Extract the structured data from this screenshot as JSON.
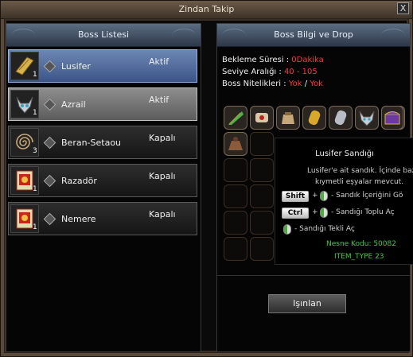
{
  "window": {
    "title": "Zindan Takip",
    "close_label": "X"
  },
  "boss_list": {
    "header": "Boss Listesi",
    "items": [
      {
        "name": "Lusifer",
        "status": "Aktif",
        "count": "1",
        "icon": "scroll-gold-icon",
        "state": "selected-blue"
      },
      {
        "name": "Azrail",
        "status": "Aktif",
        "count": "1",
        "icon": "horned-helmet-icon",
        "state": "selected-grey"
      },
      {
        "name": "Beran-Setaou",
        "status": "Kapalı",
        "count": "3",
        "icon": "spiral-icon",
        "state": "normal"
      },
      {
        "name": "Razadör",
        "status": "Kapalı",
        "count": "1",
        "icon": "red-scroll-icon",
        "state": "normal"
      },
      {
        "name": "Nemere",
        "status": "Kapalı",
        "count": "1",
        "icon": "red-scroll-icon",
        "state": "normal"
      }
    ]
  },
  "boss_info": {
    "header": "Boss Bilgi ve Drop",
    "wait_label": "Bekleme Süresi : ",
    "wait_value": "0Dakika",
    "level_label": "Seviye Aralığı : ",
    "level_value": "40 - 105",
    "attr_label": "Boss Nitelikleri : ",
    "attr_value_1": "Yok",
    "attr_sep": " / ",
    "attr_value_2": "Yok"
  },
  "drops": {
    "items": [
      "green-feather-icon",
      "scroll-bundle-icon",
      "tan-pouch-icon",
      "gold-cylinder-icon",
      "silver-cylinder-icon",
      "horned-helmet-icon",
      "treasure-chest-icon",
      "purple-chest-icon",
      "brown-sack-icon"
    ]
  },
  "tooltip": {
    "title": "Lusifer Sandığı",
    "desc_1": "Lusifer'e ait sandık. İçinde bazı",
    "desc_2": "kıymetli eşyalar mevcut.",
    "shift_key": "Shift",
    "ctrl_key": "Ctrl",
    "plus": "+",
    "shift_action": "- Sandık İçeriğini Gö",
    "ctrl_action": "- Sandığı Toplu Aç",
    "single_action": "- Sandığı Tekli Aç",
    "item_code": "Nesne Kodu: 50082",
    "item_type": "ITEM_TYPE 23"
  },
  "teleport_button": "Işınlan",
  "colors": {
    "accent_red": "#ff3a3a",
    "code_green": "#3ccf3c",
    "header_blue": "#5b6d82"
  }
}
